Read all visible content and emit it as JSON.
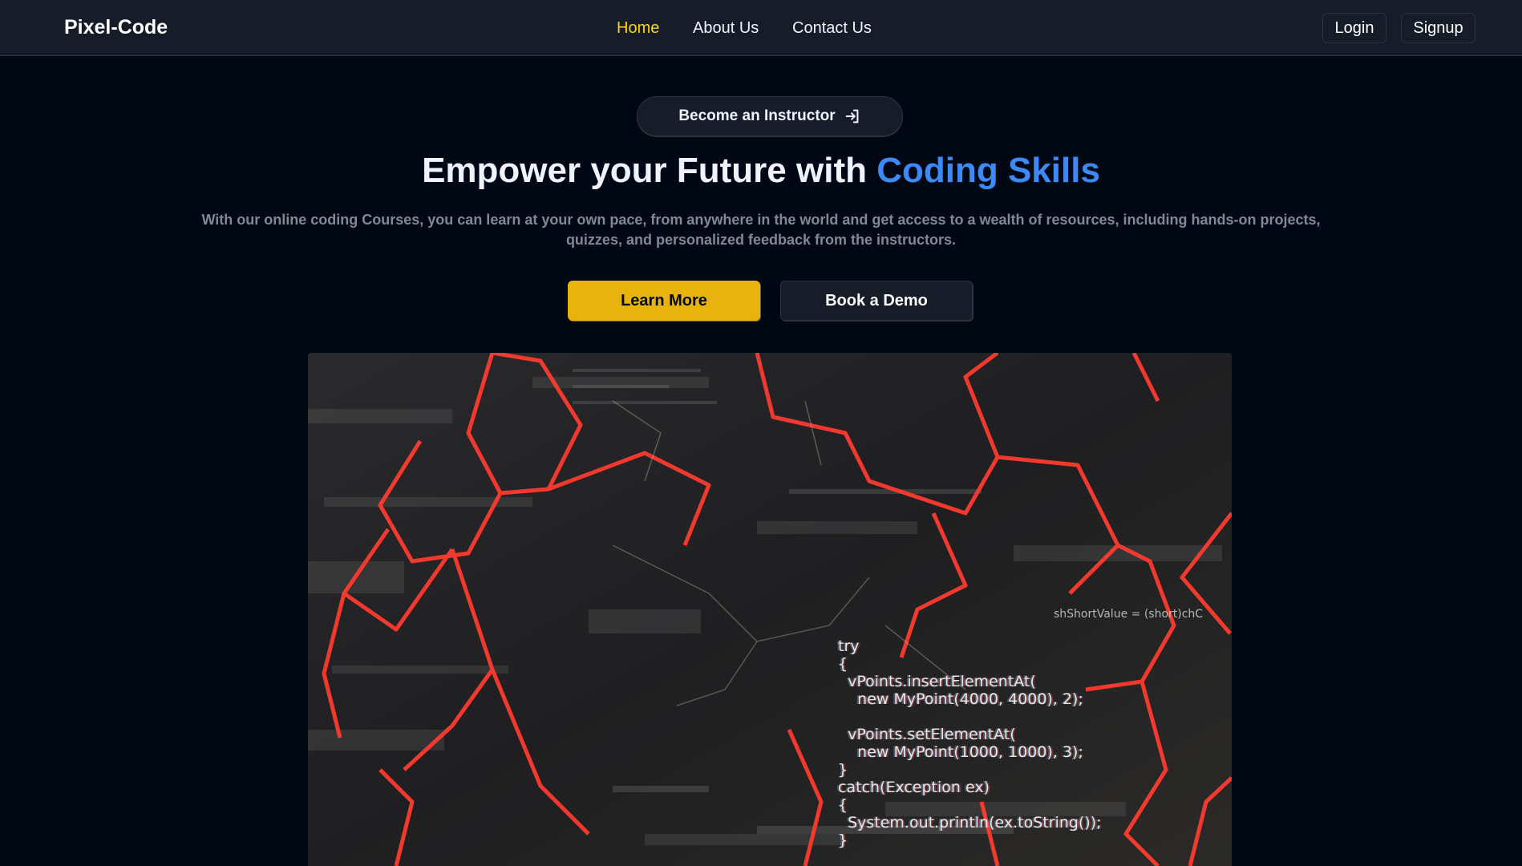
{
  "nav": {
    "logo": "Pixel-Code",
    "links": [
      {
        "label": "Home",
        "active": true
      },
      {
        "label": "About Us",
        "active": false
      },
      {
        "label": "Contact Us",
        "active": false
      }
    ],
    "login_label": "Login",
    "signup_label": "Signup"
  },
  "hero": {
    "instructor_button": "Become an Instructor",
    "heading_prefix": "Empower your Future with ",
    "heading_highlight": "Coding Skills",
    "description": "With our online coding Courses, you can learn at your own pace, from anywhere in the world and get access to a wealth of resources, including hands-on projects, quizzes, and personalized feedback from the instructors.",
    "learn_more": "Learn More",
    "book_demo": "Book a Demo"
  },
  "video": {
    "top_code": "shShortValue = (short)chC",
    "code_lines": "try\n{\n  vPoints.insertElementAt(\n    new MyPoint(4000, 4000), 2);\n\n  vPoints.setElementAt(\n    new MyPoint(1000, 1000), 3);\n}\ncatch(Exception ex)\n{\n  System.out.println(ex.toString());\n}"
  },
  "colors": {
    "background": "#000814",
    "navbar": "#161d29",
    "accent_yellow": "#e7b30c",
    "active_link": "#ffd60a",
    "highlight_blue": "#3d8af7",
    "hex_red": "#ff3b2f"
  }
}
